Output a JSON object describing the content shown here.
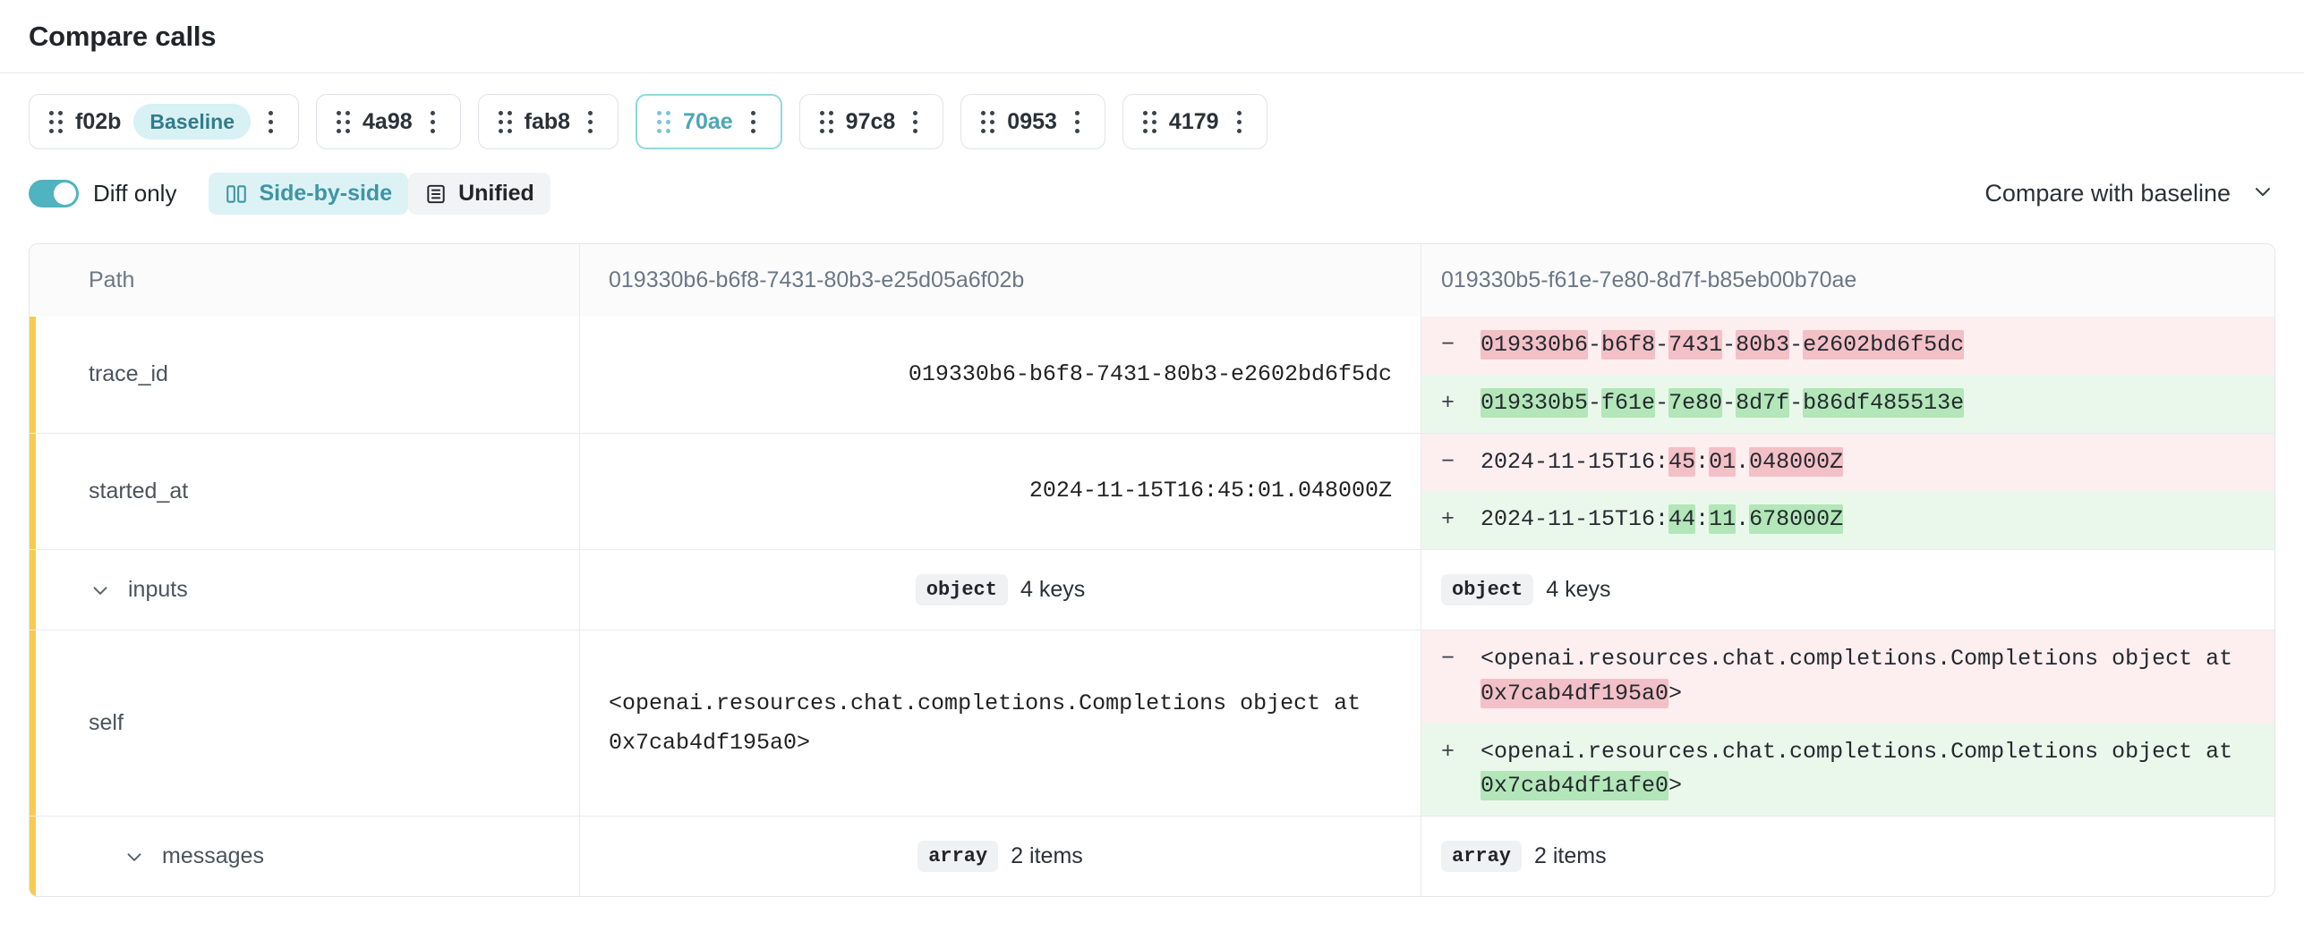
{
  "header": {
    "title": "Compare calls"
  },
  "chips": [
    {
      "id": "f02b",
      "label": "f02b",
      "badge": "Baseline",
      "selected": false
    },
    {
      "id": "4a98",
      "label": "4a98",
      "badge": null,
      "selected": false
    },
    {
      "id": "fab8",
      "label": "fab8",
      "badge": null,
      "selected": false
    },
    {
      "id": "70ae",
      "label": "70ae",
      "badge": null,
      "selected": true
    },
    {
      "id": "97c8",
      "label": "97c8",
      "badge": null,
      "selected": false
    },
    {
      "id": "0953",
      "label": "0953",
      "badge": null,
      "selected": false
    },
    {
      "id": "4179",
      "label": "4179",
      "badge": null,
      "selected": false
    }
  ],
  "toolbar": {
    "diff_only_label": "Diff only",
    "diff_only_on": true,
    "side_by_side_label": "Side-by-side",
    "unified_label": "Unified",
    "active_view": "Side-by-side",
    "compare_with_label": "Compare with baseline"
  },
  "table": {
    "headers": {
      "path": "Path",
      "baseline": "019330b6-b6f8-7431-80b3-e25d05a6f02b",
      "compare": "019330b5-f61e-7e80-8d7f-b85eb00b70ae"
    },
    "rows": [
      {
        "path": "trace_id",
        "baseline_value": "019330b6-b6f8-7431-80b3-e2602bd6f5dc",
        "del_sign": "−",
        "add_sign": "+",
        "del_parts": [
          {
            "t": "019330b6",
            "h": true
          },
          {
            "t": "-",
            "h": false
          },
          {
            "t": "b6f8",
            "h": true
          },
          {
            "t": "-",
            "h": false
          },
          {
            "t": "7431",
            "h": true
          },
          {
            "t": "-",
            "h": false
          },
          {
            "t": "80b3",
            "h": true
          },
          {
            "t": "-",
            "h": false
          },
          {
            "t": "e2602bd6f5dc",
            "h": true
          }
        ],
        "add_parts": [
          {
            "t": "019330b5",
            "h": true
          },
          {
            "t": "-",
            "h": false
          },
          {
            "t": "f61e",
            "h": true
          },
          {
            "t": "-",
            "h": false
          },
          {
            "t": "7e80",
            "h": true
          },
          {
            "t": "-",
            "h": false
          },
          {
            "t": "8d7f",
            "h": true
          },
          {
            "t": "-",
            "h": false
          },
          {
            "t": "b86df485513e",
            "h": true
          }
        ]
      },
      {
        "path": "started_at",
        "baseline_value": "2024-11-15T16:45:01.048000Z",
        "del_sign": "−",
        "add_sign": "+",
        "del_parts": [
          {
            "t": "2024-11-15T16:",
            "h": false
          },
          {
            "t": "45",
            "h": true
          },
          {
            "t": ":",
            "h": false
          },
          {
            "t": "01",
            "h": true
          },
          {
            "t": ".",
            "h": false
          },
          {
            "t": "048000Z",
            "h": true
          }
        ],
        "add_parts": [
          {
            "t": "2024-11-15T16:",
            "h": false
          },
          {
            "t": "44",
            "h": true
          },
          {
            "t": ":",
            "h": false
          },
          {
            "t": "11",
            "h": true
          },
          {
            "t": ".",
            "h": false
          },
          {
            "t": "678000Z",
            "h": true
          }
        ]
      },
      {
        "path": "inputs",
        "expandable": true,
        "indent": 1,
        "baseline_type": "object",
        "baseline_count": "4 keys",
        "compare_type": "object",
        "compare_count": "4 keys"
      },
      {
        "path": "self",
        "baseline_value": "<openai.resources.chat.completions.Completions object at 0x7cab4df195a0>",
        "del_sign": "−",
        "add_sign": "+",
        "del_parts": [
          {
            "t": "<openai.resources.chat.completions.Completions object at ",
            "h": false
          },
          {
            "t": "0x7cab4df195a0",
            "h": true
          },
          {
            "t": ">",
            "h": false
          }
        ],
        "add_parts": [
          {
            "t": "<openai.resources.chat.completions.Completions object at ",
            "h": false
          },
          {
            "t": "0x7cab4df1afe0",
            "h": true
          },
          {
            "t": ">",
            "h": false
          }
        ]
      },
      {
        "path": "messages",
        "expandable": true,
        "indent": 2,
        "baseline_type": "array",
        "baseline_count": "2 items",
        "compare_type": "array",
        "compare_count": "2 items"
      }
    ]
  },
  "icons": {
    "grip": "grip-dots-icon",
    "kebab": "kebab-menu-icon",
    "side_by_side": "columns-icon",
    "unified": "list-icon",
    "chevron_down": "chevron-down-icon",
    "twisty": "chevron-down-icon"
  },
  "colors": {
    "accent_teal": "#4fb3c0",
    "baseline_badge_bg": "#d7f1f5",
    "baseline_badge_text": "#2f7d8c",
    "diff_row_marker": "#f6cb53",
    "del_row_bg": "#fdeef0",
    "add_row_bg": "#eaf8ec",
    "del_highlight": "#f3c0c7",
    "add_highlight": "#b3e6b8"
  }
}
